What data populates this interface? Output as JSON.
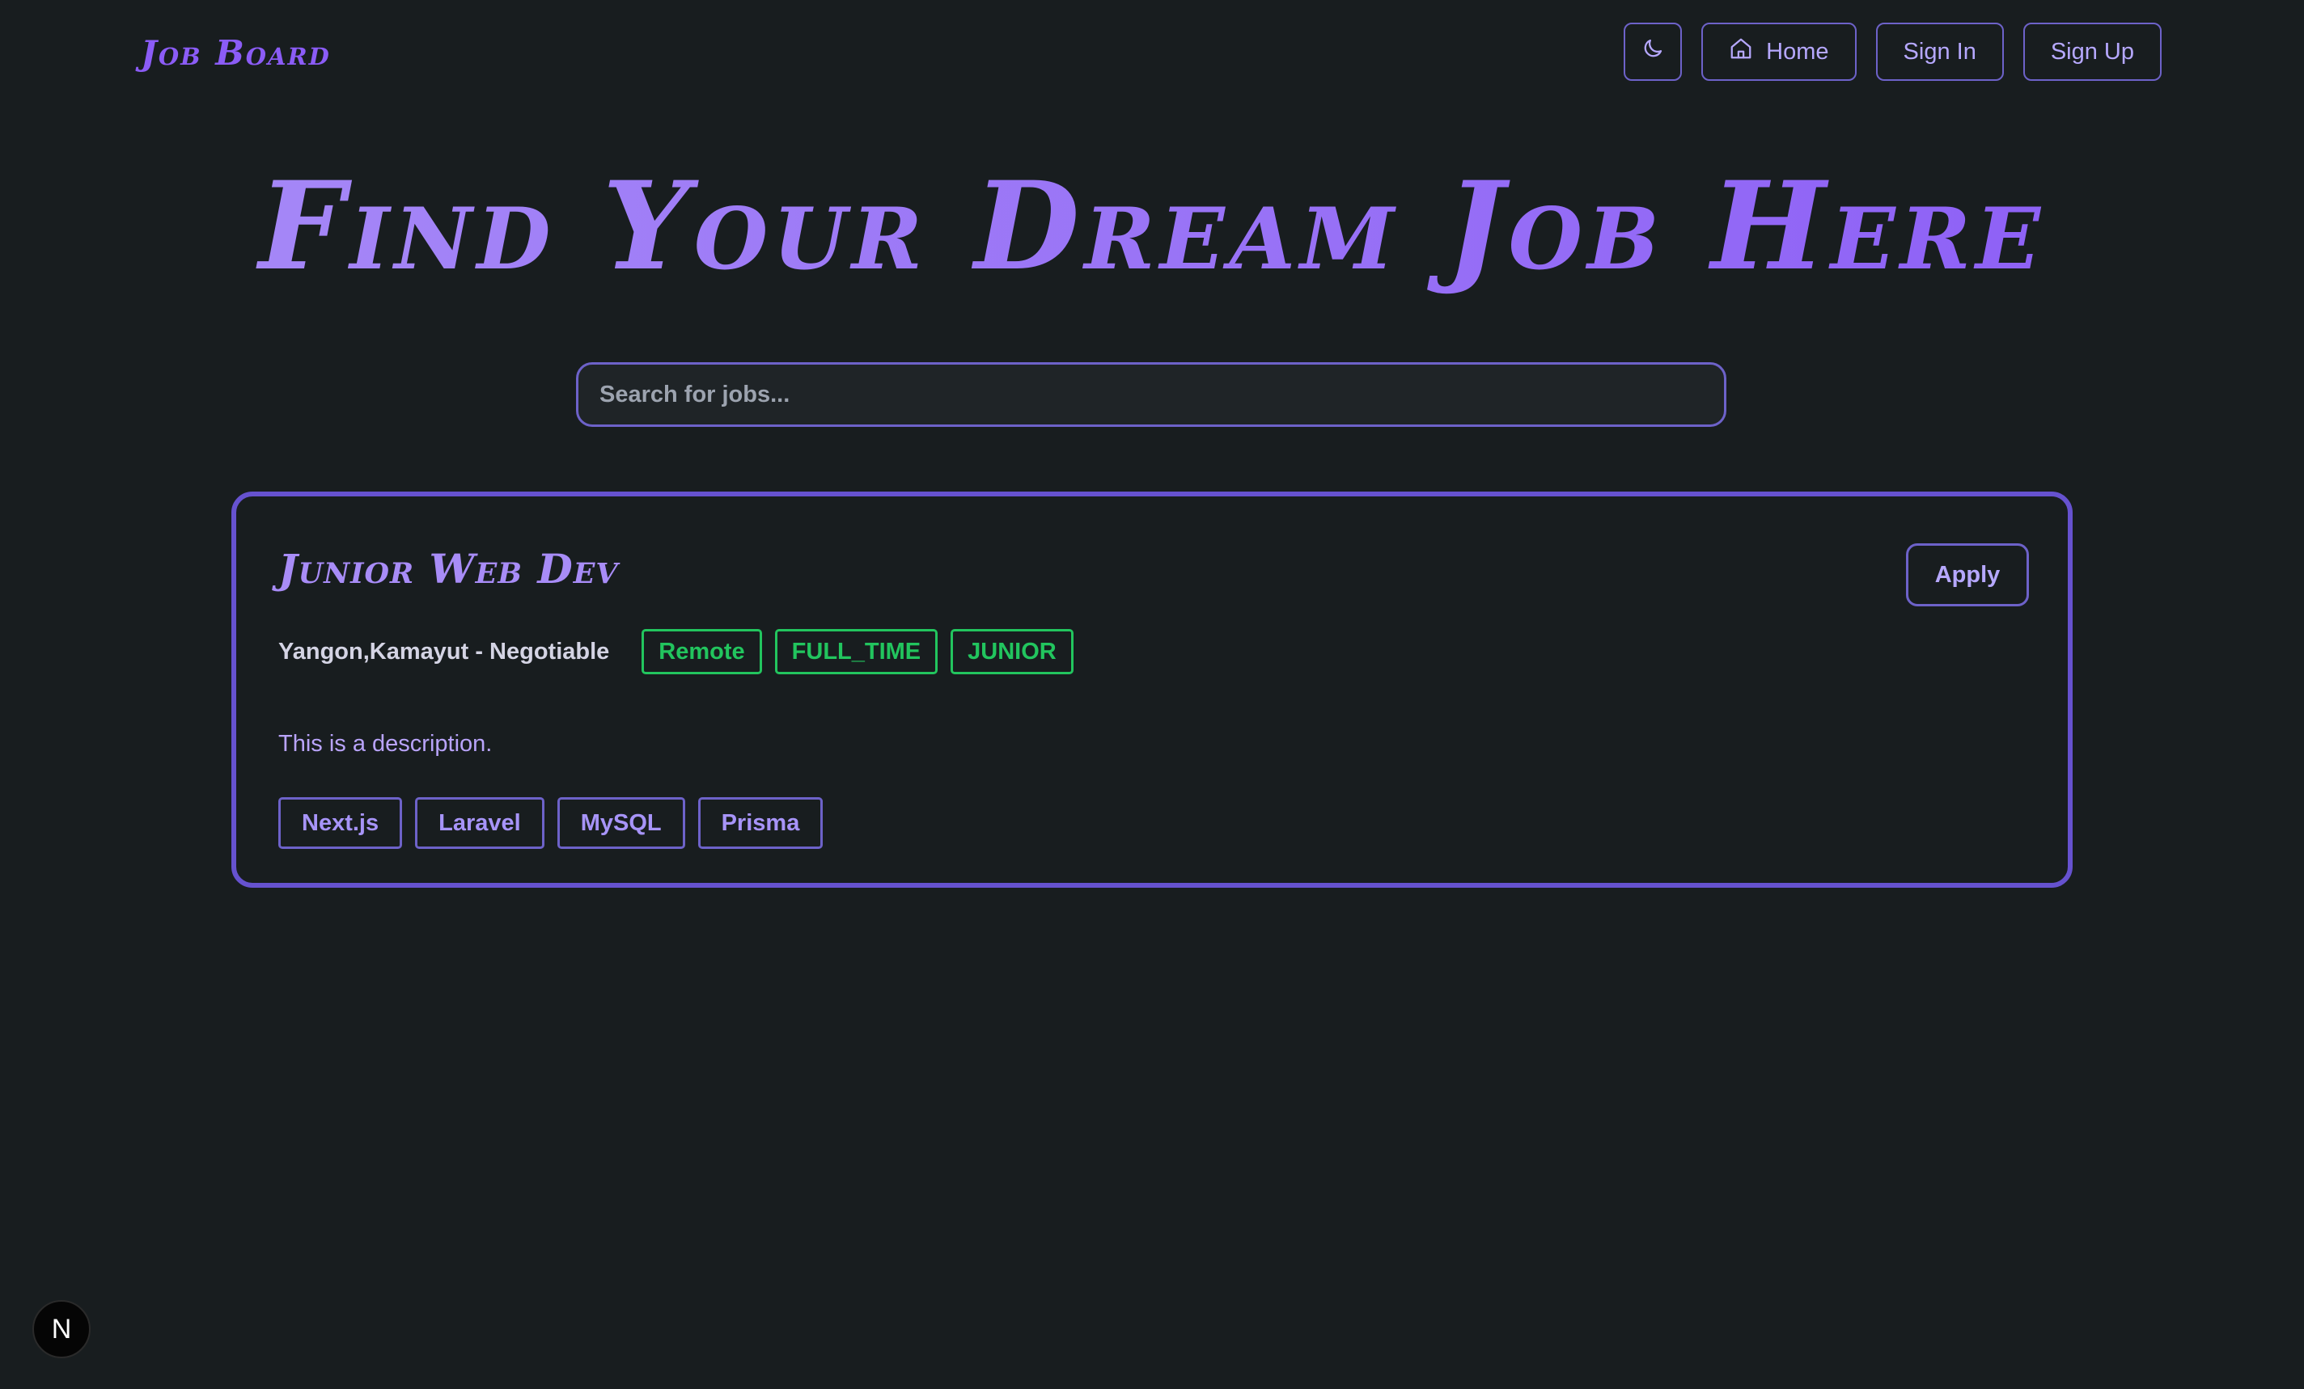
{
  "header": {
    "brand": "Job Board",
    "nav": {
      "theme_icon": "moon-icon",
      "home_icon": "home-icon",
      "home_label": "Home",
      "sign_in_label": "Sign In",
      "sign_up_label": "Sign Up"
    }
  },
  "hero": {
    "title": "Find Your Dream Job Here"
  },
  "search": {
    "placeholder": "Search for jobs...",
    "value": ""
  },
  "jobs": [
    {
      "title": "Junior Web Dev",
      "apply_label": "Apply",
      "location": "Yangon,Kamayut - Negotiable",
      "tags": [
        "Remote",
        "FULL_TIME",
        "JUNIOR"
      ],
      "description": "This is a description.",
      "skills": [
        "Next.js",
        "Laravel",
        "MySQL",
        "Prisma"
      ]
    }
  ],
  "badge": {
    "label": "N"
  },
  "colors": {
    "background": "#181d1f",
    "accent": "#8b5cf6",
    "border": "#6d62c9",
    "tag_green": "#22c55e"
  }
}
